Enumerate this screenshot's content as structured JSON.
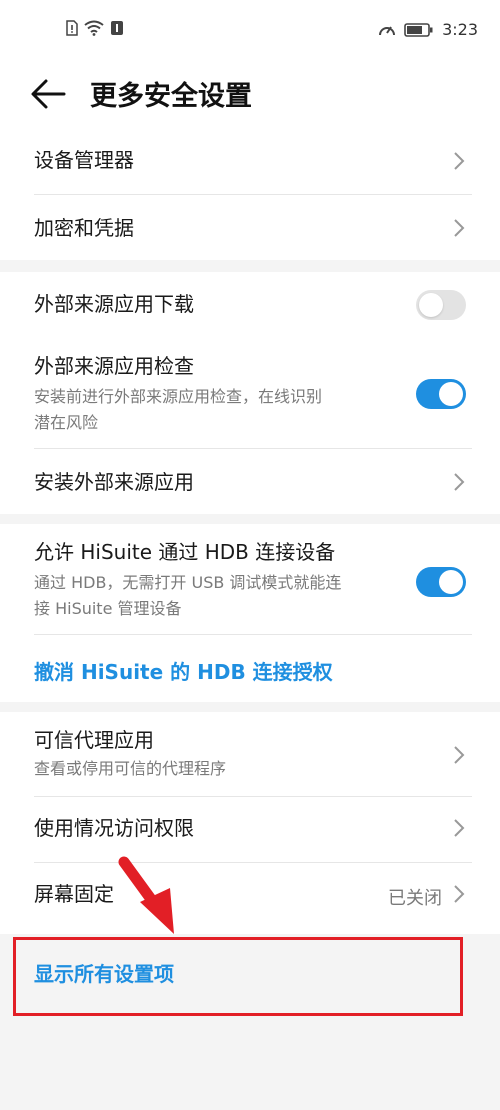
{
  "status_bar": {
    "time": "3:23",
    "icons_left": [
      "sim-alert-icon",
      "wifi-icon",
      "notification-icon"
    ],
    "icons_right": [
      "speed-icon",
      "battery-icon"
    ]
  },
  "header": {
    "title": "更多安全设置"
  },
  "section1": {
    "items": [
      {
        "label": "设备管理器"
      },
      {
        "label": "加密和凭据"
      }
    ]
  },
  "section2": {
    "external_download": {
      "label": "外部来源应用下载",
      "enabled": false
    },
    "external_check": {
      "label": "外部来源应用检查",
      "sub_line1": "安装前进行外部来源应用检查，在线识别",
      "sub_line2": "潜在风险",
      "enabled": true
    },
    "install_external": {
      "label": "安装外部来源应用"
    }
  },
  "section3": {
    "hisuite": {
      "label": "允许 HiSuite 通过 HDB 连接设备",
      "sub_line1": "通过 HDB，无需打开 USB 调试模式就能连",
      "sub_line2": "接 HiSuite 管理设备",
      "enabled": true
    },
    "revoke_link": "撤消 HiSuite 的 HDB 连接授权"
  },
  "section4": {
    "trusted_agents": {
      "label": "可信代理应用",
      "sub": "查看或停用可信的代理程序"
    },
    "usage_access": {
      "label": "使用情况访问权限"
    },
    "screen_pin": {
      "label": "屏幕固定",
      "value": "已关闭"
    }
  },
  "show_all": {
    "label": "显示所有设置项"
  },
  "colors": {
    "accent": "#1f8fe0",
    "highlight": "#e21f26"
  }
}
